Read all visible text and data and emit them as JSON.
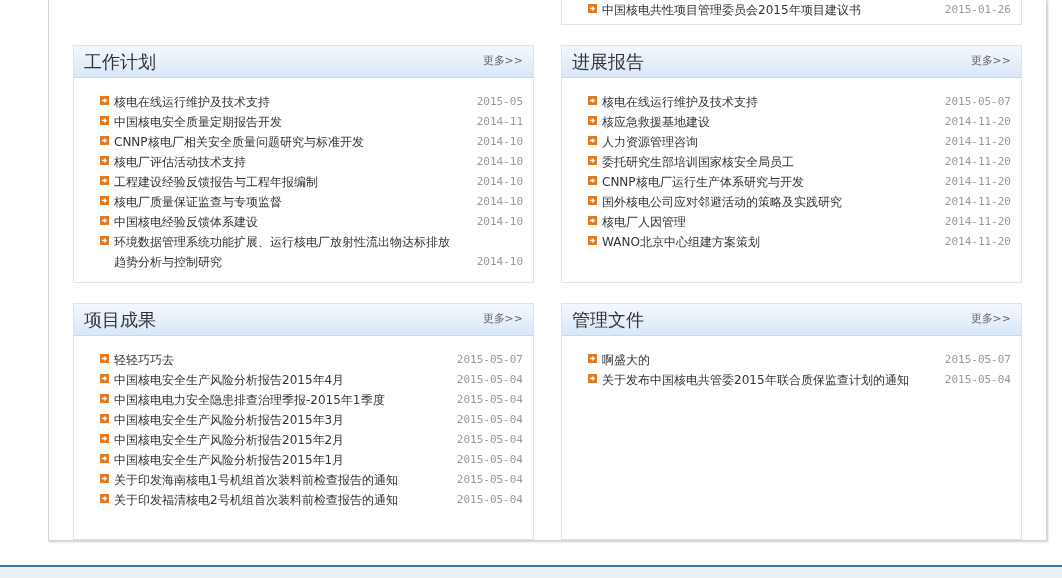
{
  "top_panel": {
    "items": [
      {
        "title": "中国核电共性项目管理委员会2015年项目建议书",
        "date": "2015-01-26"
      }
    ]
  },
  "panels": [
    {
      "title": "工作计划",
      "more": "更多>>",
      "items": [
        {
          "title": "核电在线运行维护及技术支持",
          "date": "2015-05"
        },
        {
          "title": "中国核电安全质量定期报告开发",
          "date": "2014-11"
        },
        {
          "title": "CNNP核电厂相关安全质量问题研究与标准开发",
          "date": "2014-10"
        },
        {
          "title": "核电厂评估活动技术支持",
          "date": "2014-10"
        },
        {
          "title": "工程建设经验反馈报告与工程年报编制",
          "date": "2014-10"
        },
        {
          "title": "核电厂质量保证监查与专项监督",
          "date": "2014-10"
        },
        {
          "title": "中国核电经验反馈体系建设",
          "date": "2014-10"
        },
        {
          "title": "环境数据管理系统功能扩展、运行核电厂放射性流出物达标排放趋势分析与控制研究",
          "date": "2014-10"
        }
      ]
    },
    {
      "title": "进展报告",
      "more": "更多>>",
      "items": [
        {
          "title": "核电在线运行维护及技术支持",
          "date": "2015-05-07"
        },
        {
          "title": "核应急救援基地建设",
          "date": "2014-11-20"
        },
        {
          "title": "人力资源管理咨询",
          "date": "2014-11-20"
        },
        {
          "title": "委托研究生部培训国家核安全局员工",
          "date": "2014-11-20"
        },
        {
          "title": "CNNP核电厂运行生产体系研究与开发",
          "date": "2014-11-20"
        },
        {
          "title": "国外核电公司应对邻避活动的策略及实践研究",
          "date": "2014-11-20"
        },
        {
          "title": "核电厂人因管理",
          "date": "2014-11-20"
        },
        {
          "title": "WANO北京中心组建方案策划",
          "date": "2014-11-20"
        }
      ]
    },
    {
      "title": "项目成果",
      "more": "更多>>",
      "items": [
        {
          "title": "轻轻巧巧去",
          "date": "2015-05-07"
        },
        {
          "title": "中国核电安全生产风险分析报告2015年4月",
          "date": "2015-05-04"
        },
        {
          "title": "中国核电电力安全隐患排查治理季报-2015年1季度",
          "date": "2015-05-04"
        },
        {
          "title": "中国核电安全生产风险分析报告2015年3月",
          "date": "2015-05-04"
        },
        {
          "title": "中国核电安全生产风险分析报告2015年2月",
          "date": "2015-05-04"
        },
        {
          "title": "中国核电安全生产风险分析报告2015年1月",
          "date": "2015-05-04"
        },
        {
          "title": "关于印发海南核电1号机组首次装料前检查报告的通知",
          "date": "2015-05-04"
        },
        {
          "title": "关于印发福清核电2号机组首次装料前检查报告的通知",
          "date": "2015-05-04"
        }
      ]
    },
    {
      "title": "管理文件",
      "more": "更多>>",
      "items": [
        {
          "title": "啊盛大的",
          "date": "2015-05-07"
        },
        {
          "title": "关于发布中国核电共管委2015年联合质保监查计划的通知",
          "date": "2015-05-04"
        }
      ]
    }
  ]
}
